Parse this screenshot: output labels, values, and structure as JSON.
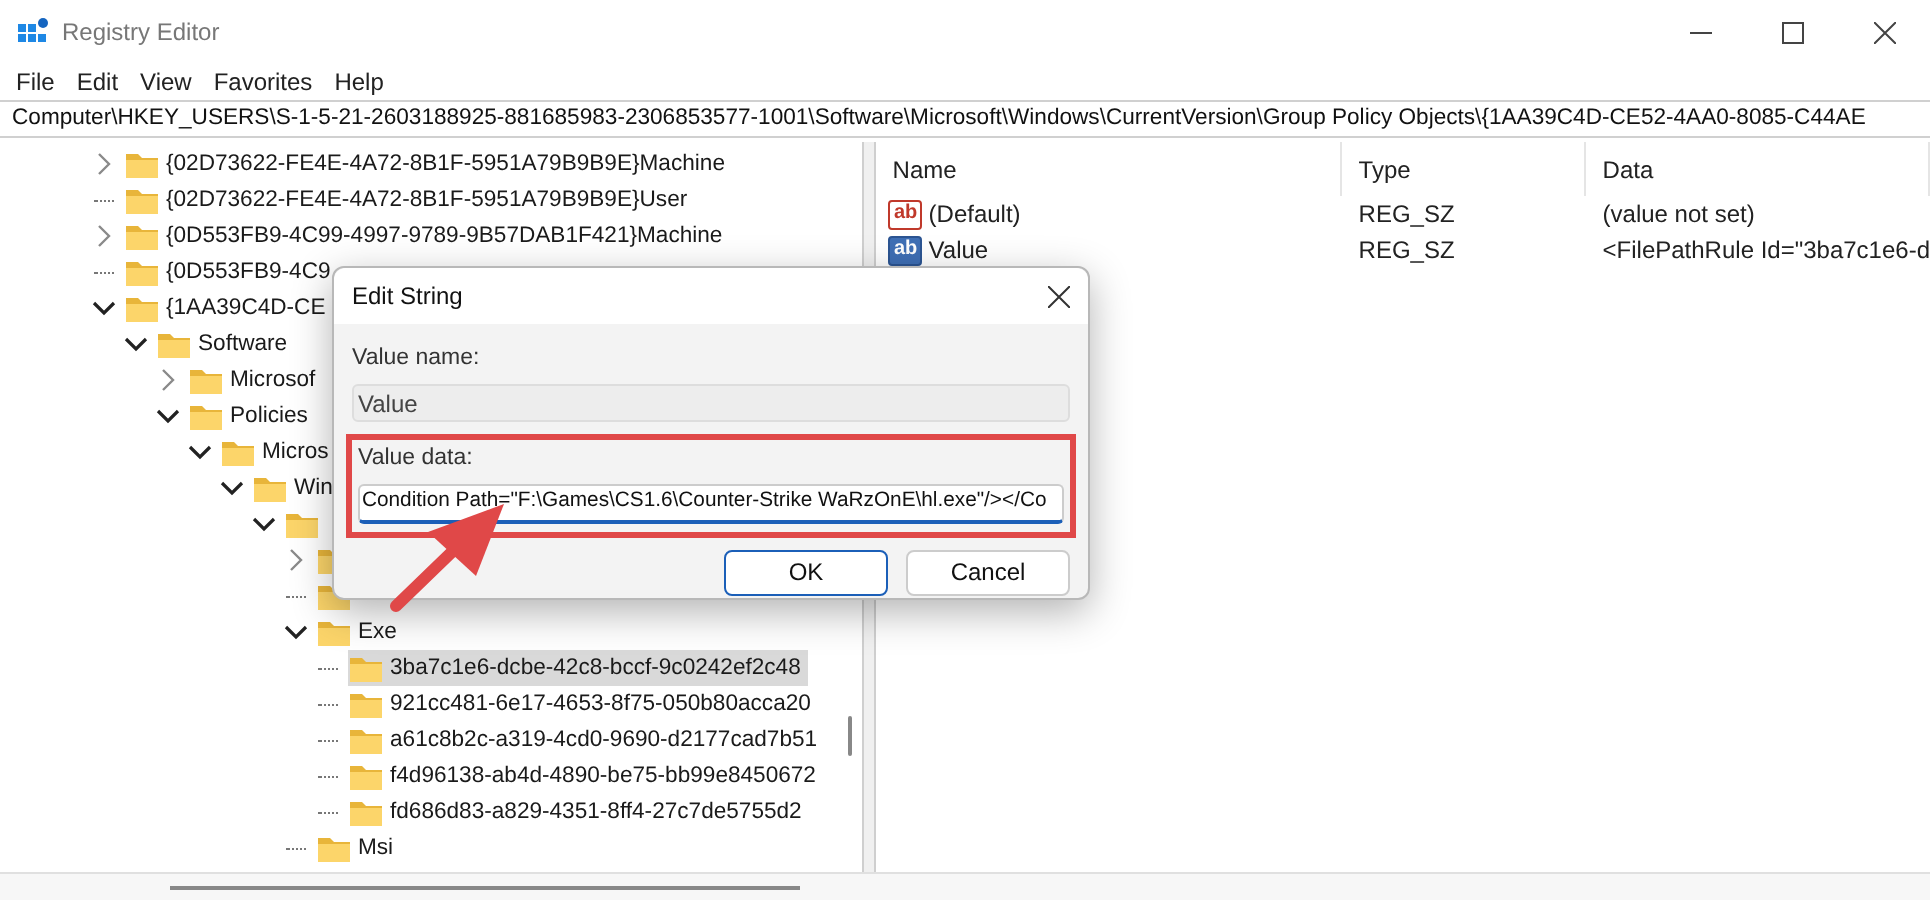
{
  "window": {
    "title": "Registry Editor"
  },
  "menu": [
    "File",
    "Edit",
    "View",
    "Favorites",
    "Help"
  ],
  "address": "Computer\\HKEY_USERS\\S-1-5-21-2603188925-881685983-2306853577-1001\\Software\\Microsoft\\Windows\\CurrentVersion\\Group Policy Objects\\{1AA39C4D-CE52-4AA0-8085-C44AE",
  "tree": [
    {
      "label": "{02D73622-FE4E-4A72-8B1F-5951A79B9B9E}Machine",
      "kind": "branch",
      "expanded": false,
      "selected": false
    },
    {
      "label": "{02D73622-FE4E-4A72-8B1F-5951A79B9B9E}User",
      "kind": "leaf",
      "selected": false
    },
    {
      "label": "{0D553FB9-4C99-4997-9789-9B57DAB1F421}Machine",
      "kind": "branch",
      "expanded": false,
      "selected": false
    },
    {
      "label": "{0D553FB9-4C9",
      "kind": "leaf",
      "selected": false
    },
    {
      "label": "{1AA39C4D-CE",
      "kind": "branch",
      "expanded": true,
      "selected": false,
      "children": [
        {
          "label": "Software",
          "kind": "branch",
          "expanded": true,
          "selected": false,
          "children": [
            {
              "label": "Microsof",
              "kind": "branch",
              "expanded": false,
              "selected": false
            },
            {
              "label": "Policies",
              "kind": "branch",
              "expanded": true,
              "selected": false,
              "children": [
                {
                  "label": "Micros",
                  "kind": "branch",
                  "expanded": true,
                  "selected": false,
                  "children": [
                    {
                      "label": "Win",
                      "kind": "branch",
                      "expanded": true,
                      "selected": false,
                      "children": [
                        {
                          "kind": "branch",
                          "expanded": true,
                          "selected": false,
                          "children": [
                            {
                              "kind": "branch",
                              "expanded": false,
                              "selected": false
                            },
                            {
                              "kind": "leaf",
                              "selected": false
                            },
                            {
                              "label": "Exe",
                              "kind": "branch",
                              "expanded": true,
                              "selected": false,
                              "children": [
                                {
                                  "label": "3ba7c1e6-dcbe-42c8-bccf-9c0242ef2c48",
                                  "kind": "leaf",
                                  "selected": true
                                },
                                {
                                  "label": "921cc481-6e17-4653-8f75-050b80acca20",
                                  "kind": "leaf",
                                  "selected": false
                                },
                                {
                                  "label": "a61c8b2c-a319-4cd0-9690-d2177cad7b51",
                                  "kind": "leaf",
                                  "selected": false
                                },
                                {
                                  "label": "f4d96138-ab4d-4890-be75-bb99e8450672",
                                  "kind": "leaf",
                                  "selected": false
                                },
                                {
                                  "label": "fd686d83-a829-4351-8ff4-27c7de5755d2",
                                  "kind": "leaf",
                                  "selected": false
                                }
                              ]
                            },
                            {
                              "label": "Msi",
                              "kind": "leaf",
                              "selected": false
                            }
                          ]
                        }
                      ]
                    }
                  ]
                }
              ]
            }
          ]
        }
      ]
    }
  ],
  "values": {
    "columns": [
      "Name",
      "Type",
      "Data"
    ],
    "rows": [
      {
        "icon": "ab",
        "name": "(Default)",
        "type": "REG_SZ",
        "data": "(value not set)",
        "kind": "string"
      },
      {
        "icon": "ab",
        "name": "Value",
        "type": "REG_SZ",
        "data": "<FilePathRule Id=\"3ba7c1e6-d",
        "kind": "selected-string"
      }
    ]
  },
  "dialog": {
    "title": "Edit String",
    "value_name_label": "Value name:",
    "value_name": "Value",
    "value_data_label": "Value data:",
    "value_data": "Condition Path=\"F:\\Games\\CS1.6\\Counter-Strike WaRzOnE\\hl.exe\"/></Co",
    "buttons": [
      "OK",
      "Cancel"
    ]
  }
}
